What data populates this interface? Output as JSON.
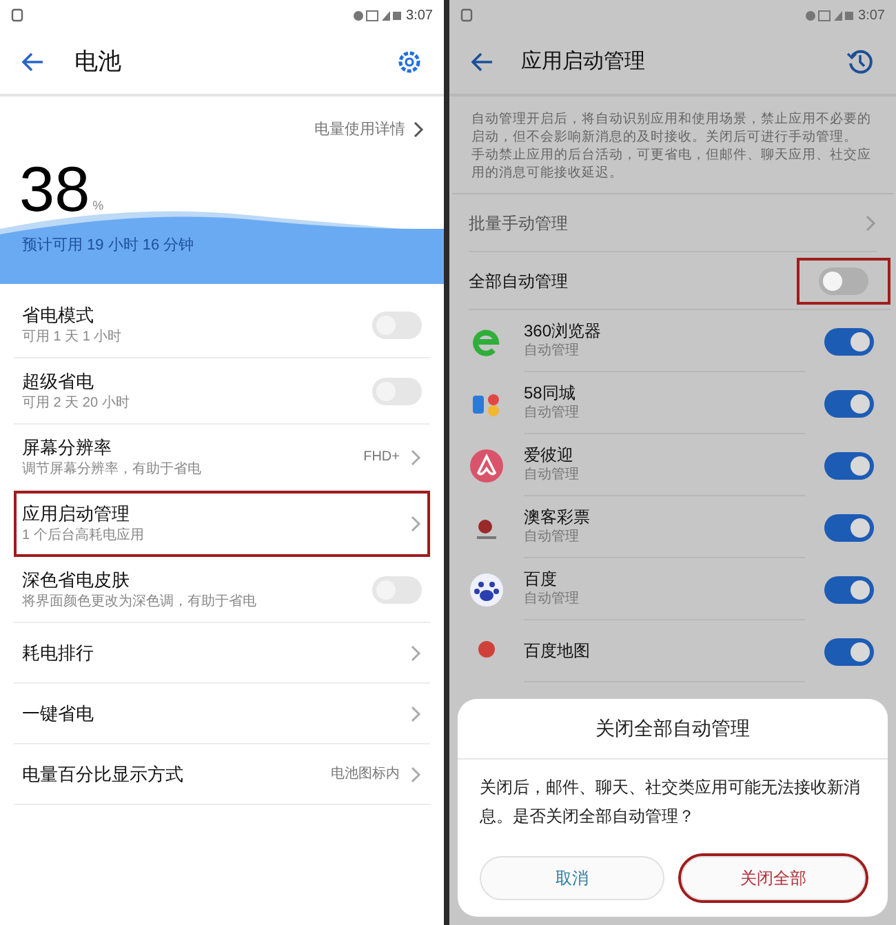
{
  "left": {
    "status_bar": {
      "time": "3:07"
    },
    "title": "电池",
    "usage_link": "电量使用详情",
    "battery": {
      "percent": "38",
      "unit": "%",
      "estimate": "预计可用 19 小时 16 分钟"
    },
    "rows": [
      {
        "kind": "toggle",
        "title": "省电模式",
        "subtitle": "可用 1 天 1 小时",
        "on": false,
        "highlighted": false
      },
      {
        "kind": "toggle",
        "title": "超级省电",
        "subtitle": "可用 2 天 20 小时",
        "on": false,
        "highlighted": false
      },
      {
        "kind": "link",
        "title": "屏幕分辨率",
        "subtitle": "调节屏幕分辨率，有助于省电",
        "value": "FHD+",
        "highlighted": false
      },
      {
        "kind": "link",
        "title": "应用启动管理",
        "subtitle": "1 个后台高耗电应用",
        "highlighted": true
      },
      {
        "kind": "toggle",
        "title": "深色省电皮肤",
        "subtitle": "将界面颜色更改为深色调，有助于省电",
        "on": false,
        "highlighted": false
      },
      {
        "kind": "link",
        "title": "耗电排行",
        "highlighted": false
      },
      {
        "kind": "link",
        "title": "一键省电",
        "highlighted": false
      },
      {
        "kind": "link",
        "title": "电量百分比显示方式",
        "value": "电池图标内",
        "highlighted": false
      }
    ]
  },
  "right": {
    "status_bar": {
      "time": "3:07"
    },
    "title": "应用启动管理",
    "description": [
      "自动管理开启后，将自动识别应用和使用场景，禁止应用不必要的启动，但不会影响新消息的及时接收。关闭后可进行手动管理。",
      "手动禁止应用的后台活动，可更省电，但邮件、聊天应用、社交应用的消息可能接收延迟。"
    ],
    "batch_manage": "批量手动管理",
    "auto_all": {
      "label": "全部自动管理",
      "on": false,
      "highlighted": true
    },
    "apps": [
      {
        "name": "360浏览器",
        "subtitle": "自动管理",
        "on": true
      },
      {
        "name": "58同城",
        "subtitle": "自动管理",
        "on": true
      },
      {
        "name": "爱彼迎",
        "subtitle": "自动管理",
        "on": true
      },
      {
        "name": "澳客彩票",
        "subtitle": "自动管理",
        "on": true
      },
      {
        "name": "百度",
        "subtitle": "自动管理",
        "on": true
      },
      {
        "name": "百度地图",
        "on": true
      }
    ],
    "dialog": {
      "title": "关闭全部自动管理",
      "message": "关闭后，邮件、聊天、社交类应用可能无法接收新消息。是否关闭全部自动管理？",
      "buttons": [
        {
          "label": "取消",
          "highlighted": false
        },
        {
          "label": "关闭全部",
          "highlighted": true
        }
      ]
    }
  }
}
